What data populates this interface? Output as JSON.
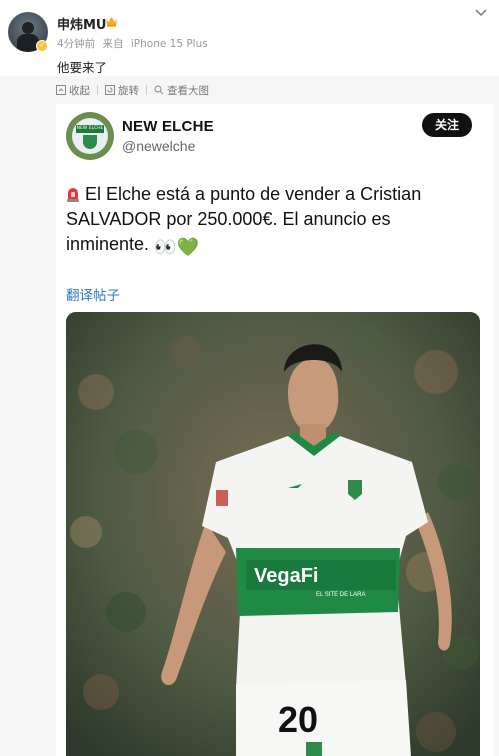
{
  "post": {
    "username": "申炜MU",
    "time": "4分钟前",
    "source_prefix": "来自",
    "source": "iPhone 15 Plus",
    "text": "他要来了"
  },
  "toolbar": {
    "collapse_label": "收起",
    "rotate_label": "旋转",
    "view_large_label": "查看大图"
  },
  "embedded_post": {
    "display_name": "NEW ELCHE",
    "handle": "@newelche",
    "follow_label": "关注",
    "avatar_text": "NEW ELCHE",
    "text": "El Elche está a punto de vender a Cristian SALVADOR por 250.000€. El anuncio es inminente.",
    "emojis": "👀💚",
    "translate_label": "翻译帖子"
  },
  "photo": {
    "sponsor_text": "VegaFi",
    "sponsor_sub": "EL SITE DE LARA",
    "shorts_number": "20"
  },
  "colors": {
    "link": "#2b7bc0",
    "elche_green": "#1e8a45",
    "follow_bg": "#111111"
  }
}
